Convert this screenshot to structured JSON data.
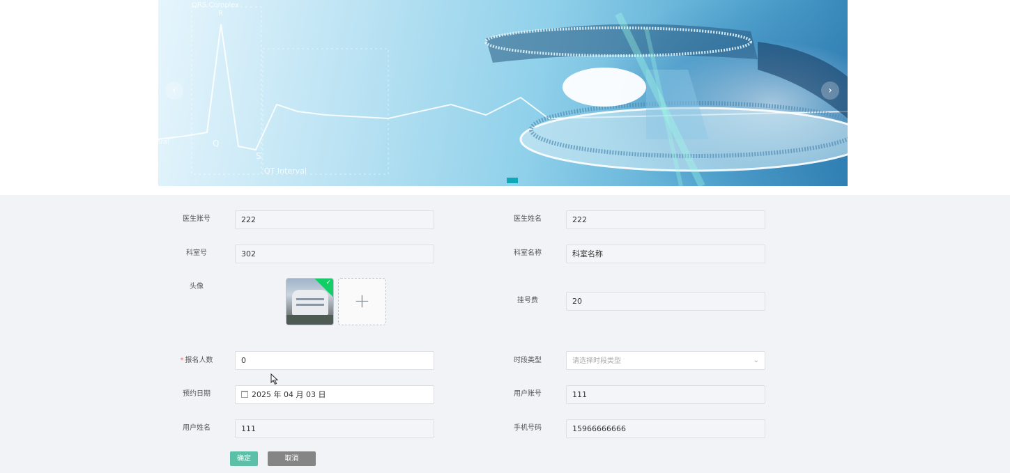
{
  "carousel": {
    "prev_icon": "‹",
    "next_icon": "›",
    "slide_count": 1,
    "active_slide": 1,
    "image_text": [
      "QRS Complex",
      "R",
      "Q",
      "S",
      "QT Interval",
      "val"
    ]
  },
  "form": {
    "doctor_account": {
      "label": "医生账号",
      "value": "222"
    },
    "doctor_name": {
      "label": "医生姓名",
      "value": "222"
    },
    "dept_no": {
      "label": "科室号",
      "value": "302"
    },
    "dept_name": {
      "label": "科室名称",
      "value": "科室名称"
    },
    "avatar": {
      "label": "头像",
      "upload_icon": "+"
    },
    "reg_fee": {
      "label": "挂号费",
      "value": "20"
    },
    "enroll_count": {
      "label": "报名人数",
      "required_mark": "*",
      "value": "0"
    },
    "time_slot_type": {
      "label": "时段类型",
      "placeholder": "请选择时段类型",
      "chevron": "⌄"
    },
    "appointment_date": {
      "label": "预约日期",
      "value": "2025 年 04 月 03 日"
    },
    "user_account": {
      "label": "用户账号",
      "value": "111"
    },
    "user_name": {
      "label": "用户姓名",
      "value": "111"
    },
    "phone": {
      "label": "手机号码",
      "value": "15966666666"
    }
  },
  "buttons": {
    "confirm": "确定",
    "cancel": "取消"
  },
  "colors": {
    "accent": "#5bc0a7",
    "indicator": "#10a7b8",
    "cancel": "#858585",
    "required": "#f56c6c"
  }
}
